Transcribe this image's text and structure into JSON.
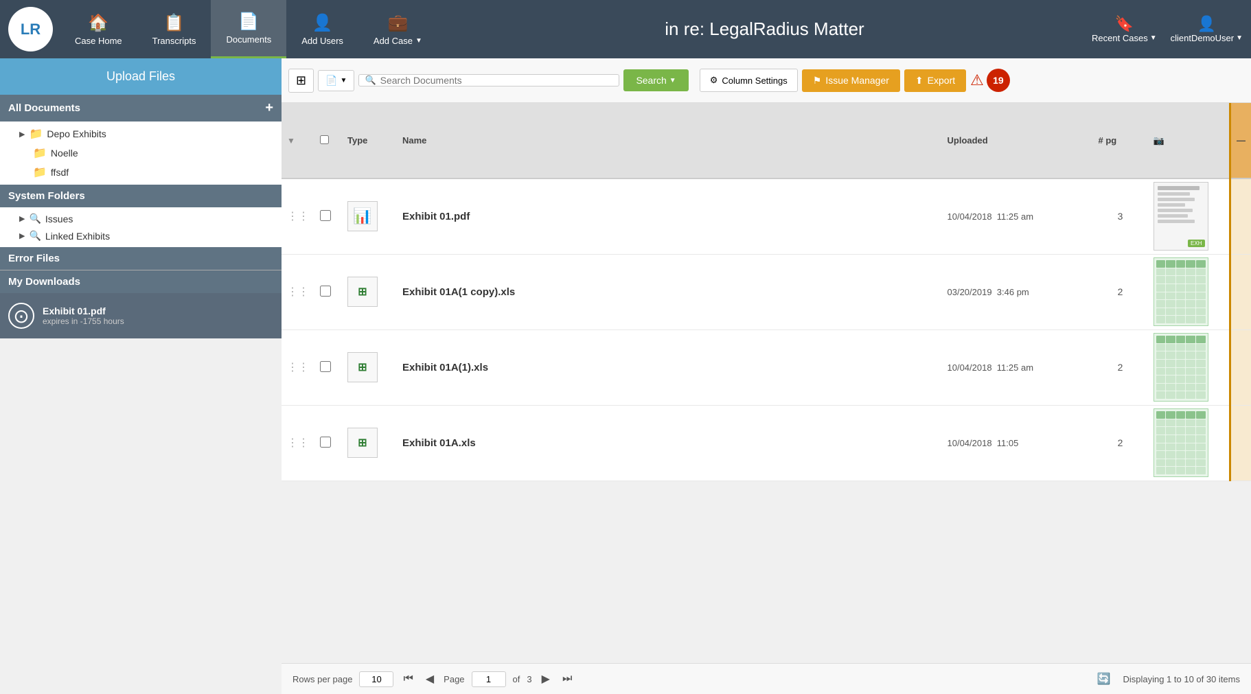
{
  "header": {
    "logo": "LR",
    "title": "in re: LegalRadius Matter",
    "nav": [
      {
        "id": "case-home",
        "label": "Case Home",
        "icon": "🏠",
        "active": false
      },
      {
        "id": "transcripts",
        "label": "Transcripts",
        "icon": "📋",
        "active": false
      },
      {
        "id": "documents",
        "label": "Documents",
        "icon": "📄",
        "active": true
      },
      {
        "id": "add-users",
        "label": "Add Users",
        "icon": "👤",
        "active": false
      },
      {
        "id": "add-case",
        "label": "Add Case",
        "icon": "💼",
        "active": false,
        "dropdown": true
      }
    ],
    "right": [
      {
        "id": "recent-cases",
        "label": "Recent Cases",
        "icon": "🔖",
        "dropdown": true
      },
      {
        "id": "user",
        "label": "clientDemoUser",
        "icon": "👤",
        "dropdown": true
      }
    ]
  },
  "sidebar": {
    "upload_label": "Upload Files",
    "all_documents": "All Documents",
    "tree": [
      {
        "id": "depo-exhibits",
        "label": "Depo Exhibits",
        "type": "folder",
        "level": 1,
        "arrow": true
      },
      {
        "id": "noelle",
        "label": "Noelle",
        "type": "folder",
        "level": 2,
        "arrow": false
      },
      {
        "id": "ffsdf",
        "label": "ffsdf",
        "type": "folder",
        "level": 2,
        "arrow": false
      }
    ],
    "system_folders": "System Folders",
    "system_items": [
      {
        "id": "issues",
        "label": "Issues",
        "type": "folder",
        "level": 1,
        "arrow": true
      },
      {
        "id": "linked-exhibits",
        "label": "Linked Exhibits",
        "type": "folder",
        "level": 1,
        "arrow": true
      }
    ],
    "error_files": "Error Files",
    "my_downloads": "My Downloads",
    "active_download": {
      "name": "Exhibit 01.pdf",
      "expires": "expires in -1755 hours"
    }
  },
  "toolbar": {
    "search_placeholder": "Search Documents",
    "search_label": "Search",
    "column_settings": "Column Settings",
    "issue_manager": "Issue Manager",
    "export": "Export",
    "alert_count": "19"
  },
  "table": {
    "columns": [
      {
        "id": "drag",
        "label": ""
      },
      {
        "id": "check",
        "label": ""
      },
      {
        "id": "type",
        "label": "Type"
      },
      {
        "id": "name",
        "label": "Name"
      },
      {
        "id": "uploaded",
        "label": "Uploaded"
      },
      {
        "id": "pages",
        "label": "# pg"
      },
      {
        "id": "thumbnail",
        "label": "📷"
      }
    ],
    "rows": [
      {
        "id": "row-1",
        "type": "pdf",
        "type_icon": "📊",
        "name": "Exhibit 01.pdf",
        "uploaded_date": "10/04/2018",
        "uploaded_time": "11:25 am",
        "pages": "3",
        "thumb_type": "pdf"
      },
      {
        "id": "row-2",
        "type": "xls",
        "type_icon": "⊞",
        "name": "Exhibit 01A(1 copy).xls",
        "uploaded_date": "03/20/2019",
        "uploaded_time": "3:46 pm",
        "pages": "2",
        "thumb_type": "xls"
      },
      {
        "id": "row-3",
        "type": "xls",
        "type_icon": "⊞",
        "name": "Exhibit 01A(1).xls",
        "uploaded_date": "10/04/2018",
        "uploaded_time": "11:25 am",
        "pages": "2",
        "thumb_type": "xls"
      },
      {
        "id": "row-4",
        "type": "xls",
        "type_icon": "⊞",
        "name": "Exhibit 01A.xls",
        "uploaded_date": "10/04/2018",
        "uploaded_time": "11:05",
        "pages": "2",
        "thumb_type": "xls"
      }
    ]
  },
  "pagination": {
    "rows_per_page_label": "Rows per page",
    "rows_per_page_value": "10",
    "page_label": "Page",
    "page_value": "1",
    "of_label": "of",
    "total_pages": "3",
    "display_info": "Displaying 1 to 10 of 30 items"
  }
}
